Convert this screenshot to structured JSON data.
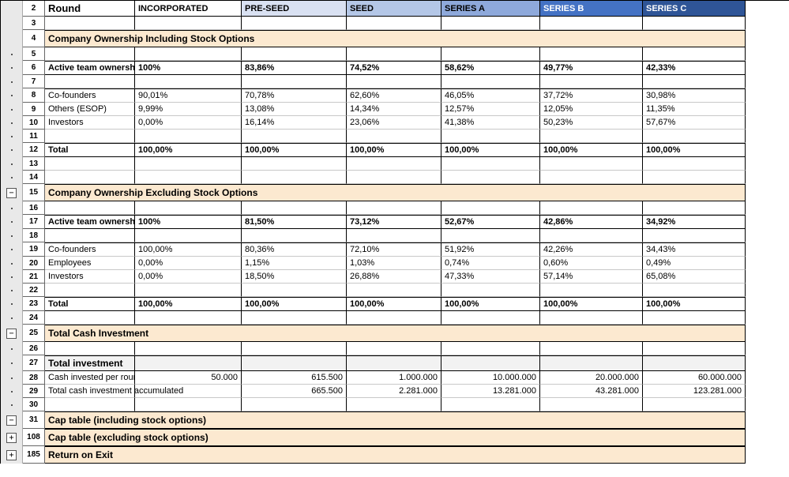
{
  "headers": {
    "round": "Round",
    "cols": [
      "INCORPORATED",
      "PRE-SEED",
      "SEED",
      "SERIES A",
      "SERIES B",
      "SERIES C"
    ]
  },
  "rows": {
    "r2": "2",
    "r3": "3",
    "r4": "4",
    "r5": "5",
    "r6": "6",
    "r7": "7",
    "r8": "8",
    "r9": "9",
    "r10": "10",
    "r11": "11",
    "r12": "12",
    "r13": "13",
    "r14": "14",
    "r15": "15",
    "r16": "16",
    "r17": "17",
    "r18": "18",
    "r19": "19",
    "r20": "20",
    "r21": "21",
    "r22": "22",
    "r23": "23",
    "r24": "24",
    "r25": "25",
    "r26": "26",
    "r27": "27",
    "r28": "28",
    "r29": "29",
    "r30": "30",
    "r31": "31",
    "r108": "108",
    "r185": "185"
  },
  "sections": {
    "s1": "Company Ownership Including Stock Options",
    "s2": "Company Ownership Excluding Stock Options",
    "s3": "Total Cash Investment",
    "s4": "Cap table (including stock options)",
    "s5": "Cap table (excluding stock options)",
    "s6": "Return on Exit"
  },
  "labels": {
    "active": "Active team ownership",
    "cof": "Co-founders",
    "others": "Others (ESOP)",
    "emp": "Employees",
    "inv": "Investors",
    "total": "Total",
    "totinv": "Total investment",
    "cashper": "Cash invested per round",
    "cashacc": "Total cash investment accumulated"
  },
  "grid": {
    "active1": [
      "100%",
      "83,86%",
      "74,52%",
      "58,62%",
      "49,77%",
      "42,33%"
    ],
    "cof1": [
      "90,01%",
      "70,78%",
      "62,60%",
      "46,05%",
      "37,72%",
      "30,98%"
    ],
    "others1": [
      "9,99%",
      "13,08%",
      "14,34%",
      "12,57%",
      "12,05%",
      "11,35%"
    ],
    "inv1": [
      "0,00%",
      "16,14%",
      "23,06%",
      "41,38%",
      "50,23%",
      "57,67%"
    ],
    "tot1": [
      "100,00%",
      "100,00%",
      "100,00%",
      "100,00%",
      "100,00%",
      "100,00%"
    ],
    "active2": [
      "100%",
      "81,50%",
      "73,12%",
      "52,67%",
      "42,86%",
      "34,92%"
    ],
    "cof2": [
      "100,00%",
      "80,36%",
      "72,10%",
      "51,92%",
      "42,26%",
      "34,43%"
    ],
    "emp2": [
      "0,00%",
      "1,15%",
      "1,03%",
      "0,74%",
      "0,60%",
      "0,49%"
    ],
    "inv2": [
      "0,00%",
      "18,50%",
      "26,88%",
      "47,33%",
      "57,14%",
      "65,08%"
    ],
    "tot2": [
      "100,00%",
      "100,00%",
      "100,00%",
      "100,00%",
      "100,00%",
      "100,00%"
    ],
    "cashper": [
      "50.000",
      "615.500",
      "1.000.000",
      "10.000.000",
      "20.000.000",
      "60.000.000"
    ],
    "cashacc": [
      "",
      "665.500",
      "2.281.000",
      "13.281.000",
      "43.281.000",
      "123.281.000"
    ]
  },
  "outline": {
    "minus": "−",
    "plus": "+"
  }
}
